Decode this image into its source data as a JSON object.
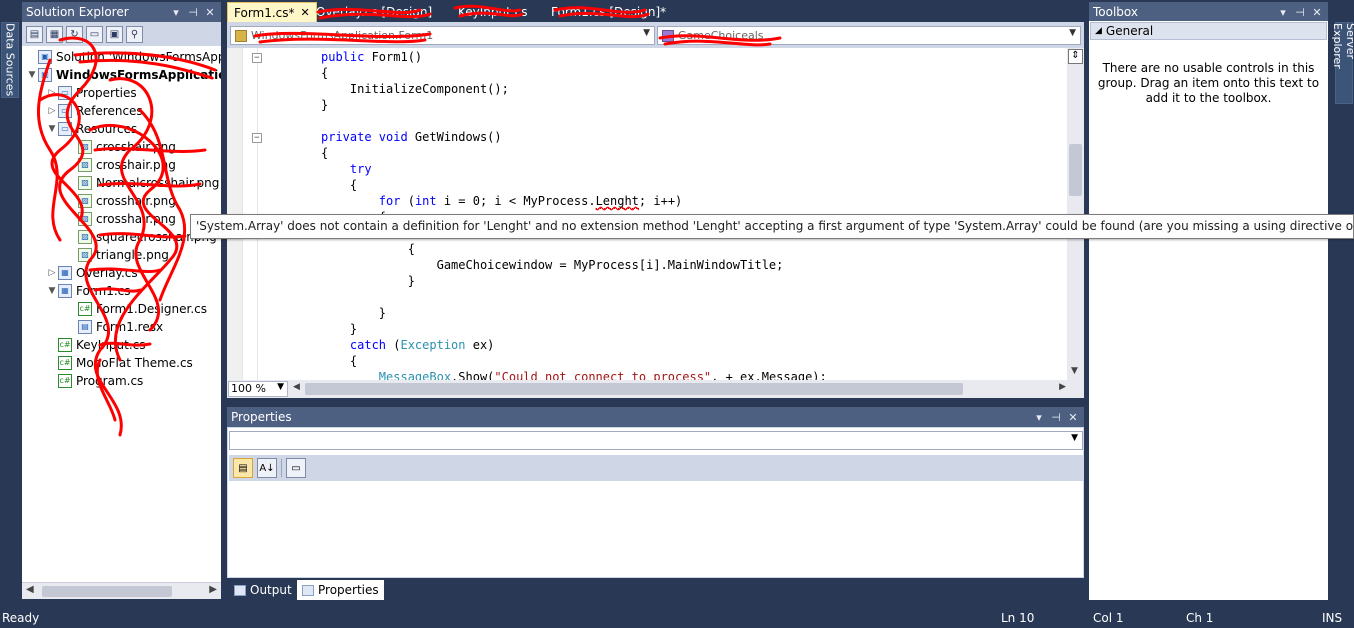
{
  "side_tabs": {
    "left": "Data Sources",
    "right": "Server Explorer"
  },
  "solution_explorer": {
    "title": "Solution Explorer",
    "tree": [
      {
        "label": "Solution 'WindowsFormsApplic",
        "depth": 0,
        "expander": "",
        "icon": "solution",
        "bold": false
      },
      {
        "label": "WindowsFormsApplication",
        "depth": 0,
        "expander": "▼",
        "icon": "project",
        "bold": true
      },
      {
        "label": "Properties",
        "depth": 1,
        "expander": "▷",
        "icon": "folder",
        "bold": false
      },
      {
        "label": "References",
        "depth": 1,
        "expander": "▷",
        "icon": "folder",
        "bold": false
      },
      {
        "label": "Resources",
        "depth": 1,
        "expander": "▼",
        "icon": "folder",
        "bold": false
      },
      {
        "label": "crosshair.png",
        "depth": 2,
        "expander": "",
        "icon": "image",
        "bold": false
      },
      {
        "label": "crosshair.png",
        "depth": 2,
        "expander": "",
        "icon": "image",
        "bold": false
      },
      {
        "label": "Normalcrosshair.png",
        "depth": 2,
        "expander": "",
        "icon": "image",
        "bold": false
      },
      {
        "label": "crosshair.png",
        "depth": 2,
        "expander": "",
        "icon": "image",
        "bold": false
      },
      {
        "label": "crosshair.png",
        "depth": 2,
        "expander": "",
        "icon": "image",
        "bold": false
      },
      {
        "label": "squarecrosshair.png",
        "depth": 2,
        "expander": "",
        "icon": "image",
        "bold": false
      },
      {
        "label": "triangle.png",
        "depth": 2,
        "expander": "",
        "icon": "image",
        "bold": false
      },
      {
        "label": "Overlay.cs",
        "depth": 1,
        "expander": "▷",
        "icon": "form",
        "bold": false
      },
      {
        "label": "Form1.cs",
        "depth": 1,
        "expander": "▼",
        "icon": "form",
        "bold": false
      },
      {
        "label": "Form1.Designer.cs",
        "depth": 2,
        "expander": "",
        "icon": "cs",
        "bold": false
      },
      {
        "label": "Form1.resx",
        "depth": 2,
        "expander": "",
        "icon": "resx",
        "bold": false
      },
      {
        "label": "KeyInput.cs",
        "depth": 1,
        "expander": "",
        "icon": "cs",
        "bold": false
      },
      {
        "label": "MonoFlat Theme.cs",
        "depth": 1,
        "expander": "",
        "icon": "cs",
        "bold": false
      },
      {
        "label": "Program.cs",
        "depth": 1,
        "expander": "",
        "icon": "cs",
        "bold": false
      }
    ]
  },
  "doc_tabs": [
    {
      "label": "Form1.cs*",
      "active": true
    },
    {
      "label": "Overlay.cs [Design]",
      "active": false
    },
    {
      "label": "KeyInput.cs",
      "active": false
    },
    {
      "label": "Form1.cs [Design]*",
      "active": false
    }
  ],
  "nav_bar": {
    "left_combo": "WindowsFormsApplication.Form1",
    "right_combo": "GameChoiceals"
  },
  "code_lines": [
    {
      "n": 0,
      "segs": [
        [
          "kw",
          "public "
        ],
        [
          "",
          "Form1()"
        ]
      ]
    },
    {
      "n": 1,
      "segs": [
        [
          "",
          "{"
        ]
      ]
    },
    {
      "n": 2,
      "segs": [
        [
          "",
          "    InitializeComponent();"
        ]
      ]
    },
    {
      "n": 3,
      "segs": [
        [
          "",
          "}"
        ]
      ]
    },
    {
      "n": 4,
      "segs": [
        [
          "",
          ""
        ]
      ]
    },
    {
      "n": 5,
      "segs": [
        [
          "kw",
          "private void "
        ],
        [
          "",
          "GetWindows()"
        ]
      ]
    },
    {
      "n": 6,
      "segs": [
        [
          "",
          "{"
        ]
      ]
    },
    {
      "n": 7,
      "segs": [
        [
          "kw",
          "    try"
        ]
      ]
    },
    {
      "n": 8,
      "segs": [
        [
          "",
          "    {"
        ]
      ]
    },
    {
      "n": 9,
      "segs": [
        [
          "kw",
          "        for "
        ],
        [
          "",
          "("
        ],
        [
          "kw",
          "int "
        ],
        [
          "",
          "i = 0; i < MyProcess."
        ],
        [
          "err",
          "Lenght"
        ],
        [
          "",
          "; i++)"
        ]
      ]
    },
    {
      "n": 10,
      "segs": [
        [
          "",
          "        {"
        ]
      ]
    },
    {
      "n": 11,
      "segs": [
        [
          "",
          "            "
        ]
      ]
    },
    {
      "n": 12,
      "segs": [
        [
          "",
          "            {"
        ]
      ]
    },
    {
      "n": 13,
      "segs": [
        [
          "",
          "                GameChoicewindow = MyProcess[i].MainWindowTitle;"
        ]
      ]
    },
    {
      "n": 14,
      "segs": [
        [
          "",
          "            }"
        ]
      ]
    },
    {
      "n": 15,
      "segs": [
        [
          "",
          ""
        ]
      ]
    },
    {
      "n": 16,
      "segs": [
        [
          "",
          "        }"
        ]
      ]
    },
    {
      "n": 17,
      "segs": [
        [
          "",
          "    }"
        ]
      ]
    },
    {
      "n": 18,
      "segs": [
        [
          "kw",
          "    catch "
        ],
        [
          "",
          "("
        ],
        [
          "ty",
          "Exception "
        ],
        [
          "",
          "ex)"
        ]
      ]
    },
    {
      "n": 19,
      "segs": [
        [
          "",
          "    {"
        ]
      ]
    },
    {
      "n": 20,
      "segs": [
        [
          "ty",
          "        MessageBox"
        ],
        [
          "",
          ".Show("
        ],
        [
          "st",
          "\"Could not connect to process\""
        ],
        [
          "",
          ", + ex.Message);"
        ]
      ]
    }
  ],
  "tooltip": "'System.Array' does not contain a definition for 'Lenght' and no extension method 'Lenght' accepting a first argument of type 'System.Array' could be found (are you missing a using directive or an assembly reference?)",
  "editor": {
    "zoom": "100 %"
  },
  "properties": {
    "title": "Properties",
    "combo_value": ""
  },
  "bottom_tabs": [
    {
      "label": "Output",
      "active": false
    },
    {
      "label": "Properties",
      "active": true
    }
  ],
  "toolbox": {
    "title": "Toolbox",
    "section": "General",
    "empty_message": "There are no usable controls in this group. Drag an item onto this text to add it to the toolbox."
  },
  "status": {
    "ready": "Ready",
    "ln": "Ln 10",
    "col": "Col 1",
    "ch": "Ch 1",
    "mode": "INS"
  },
  "colors": {
    "chrome": "#293955",
    "header": "#4d6082",
    "scribble": "#ff0000"
  }
}
